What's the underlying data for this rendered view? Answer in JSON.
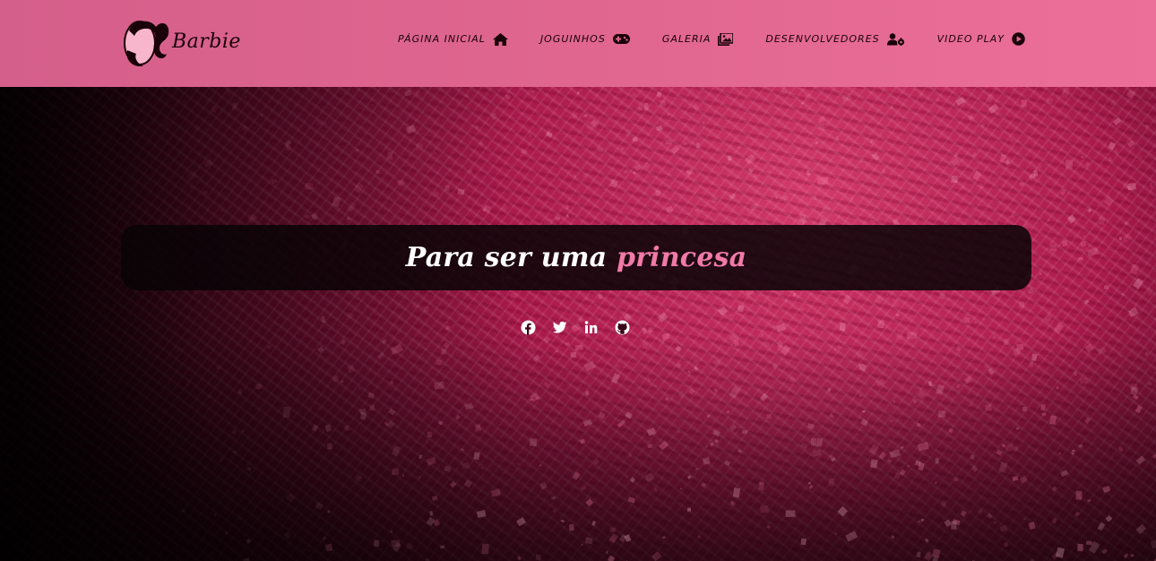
{
  "brand": {
    "name": "Barbie",
    "logo_icon": "barbie-silhouette-icon"
  },
  "nav": {
    "items": [
      {
        "label": "Página Inicial",
        "icon": "home-icon"
      },
      {
        "label": "Joguinhos",
        "icon": "gamepad-icon"
      },
      {
        "label": "Galeria",
        "icon": "images-icon"
      },
      {
        "label": "Desenvolvedores",
        "icon": "users-cog-icon"
      },
      {
        "label": "Video Play",
        "icon": "play-circle-icon"
      }
    ]
  },
  "hero": {
    "title_prefix": "Para ser uma ",
    "title_accent": "princesa"
  },
  "social": [
    {
      "icon": "facebook-icon"
    },
    {
      "icon": "twitter-icon"
    },
    {
      "icon": "linkedin-icon"
    },
    {
      "icon": "github-icon"
    }
  ],
  "colors": {
    "navbar": "#e0668f",
    "accent": "#f07aa8",
    "hero_box": "#080406",
    "background": "#a8194a"
  }
}
